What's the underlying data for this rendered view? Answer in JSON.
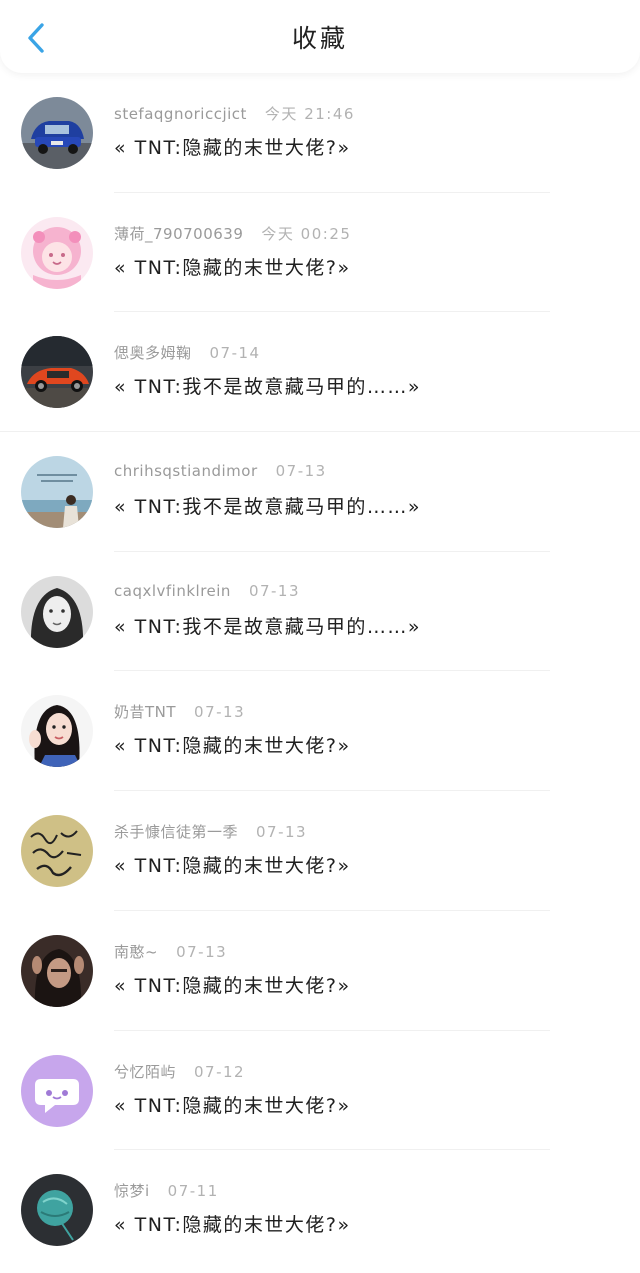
{
  "header": {
    "title": "收藏",
    "back_icon": "chevron-left-icon",
    "accent_color": "#3aa4e6"
  },
  "items": [
    {
      "username": "stefaqgnoriccjict",
      "time": "今天 21:46",
      "content": "« TNT:隐藏的末世大佬?»",
      "avatar": "rally-car-avatar"
    },
    {
      "username": "薄荷_790700639",
      "time": "今天 00:25",
      "content": "« TNT:隐藏的末世大佬?»",
      "avatar": "pink-anime-girl-avatar"
    },
    {
      "username": "偲奥多姆鞠",
      "time": "07-14",
      "content": "« TNT:我不是故意藏马甲的……»",
      "avatar": "orange-sports-car-avatar"
    },
    {
      "username": "chrihsqstiandimor",
      "time": "07-13",
      "content": "« TNT:我不是故意藏马甲的……»",
      "avatar": "seaside-girl-avatar"
    },
    {
      "username": "caqxlvfinklrein",
      "time": "07-13",
      "content": "« TNT:我不是故意藏马甲的……»",
      "avatar": "monochrome-girl-avatar"
    },
    {
      "username": "奶昔TNT",
      "time": "07-13",
      "content": "« TNT:隐藏的末世大佬?»",
      "avatar": "waving-girl-avatar"
    },
    {
      "username": "杀手慷信徒第一季",
      "time": "07-13",
      "content": "« TNT:隐藏的末世大佬?»",
      "avatar": "handwriting-avatar"
    },
    {
      "username": "南憨~",
      "time": "07-13",
      "content": "« TNT:隐藏的末世大佬?»",
      "avatar": "dark-portrait-avatar"
    },
    {
      "username": "兮忆陌屿",
      "time": "07-12",
      "content": "« TNT:隐藏的末世大佬?»",
      "avatar": "chat-bubble-avatar"
    },
    {
      "username": "惊梦i",
      "time": "07-11",
      "content": "« TNT:隐藏的末世大佬?»",
      "avatar": "teal-planet-avatar"
    }
  ]
}
